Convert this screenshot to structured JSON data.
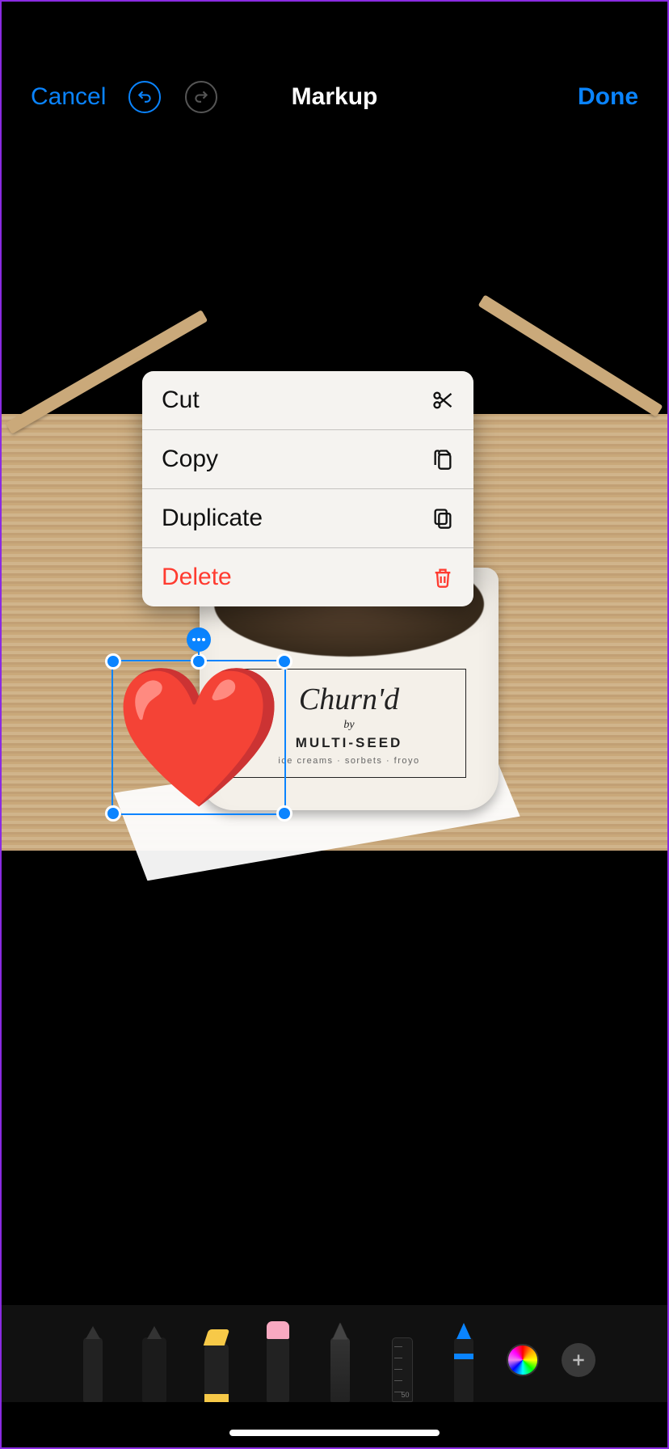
{
  "header": {
    "cancel": "Cancel",
    "title": "Markup",
    "done": "Done"
  },
  "context_menu": {
    "items": [
      {
        "label": "Cut",
        "icon": "scissors-icon"
      },
      {
        "label": "Copy",
        "icon": "copy-icon"
      },
      {
        "label": "Duplicate",
        "icon": "duplicate-icon"
      },
      {
        "label": "Delete",
        "icon": "trash-icon",
        "destructive": true
      }
    ]
  },
  "canvas": {
    "cup_brand": "Churn'd",
    "cup_by": "by",
    "cup_sub": "MULTI-SEED",
    "cup_tag": "ice creams · sorbets · froyo",
    "selected_emoji": "❤️"
  },
  "toolbar": {
    "tools": [
      "pen",
      "marker",
      "highlighter",
      "eraser",
      "lasso",
      "ruler",
      "brush"
    ],
    "ruler_value": "50"
  },
  "colors": {
    "accent": "#0a84ff",
    "destructive": "#ff3b30"
  }
}
